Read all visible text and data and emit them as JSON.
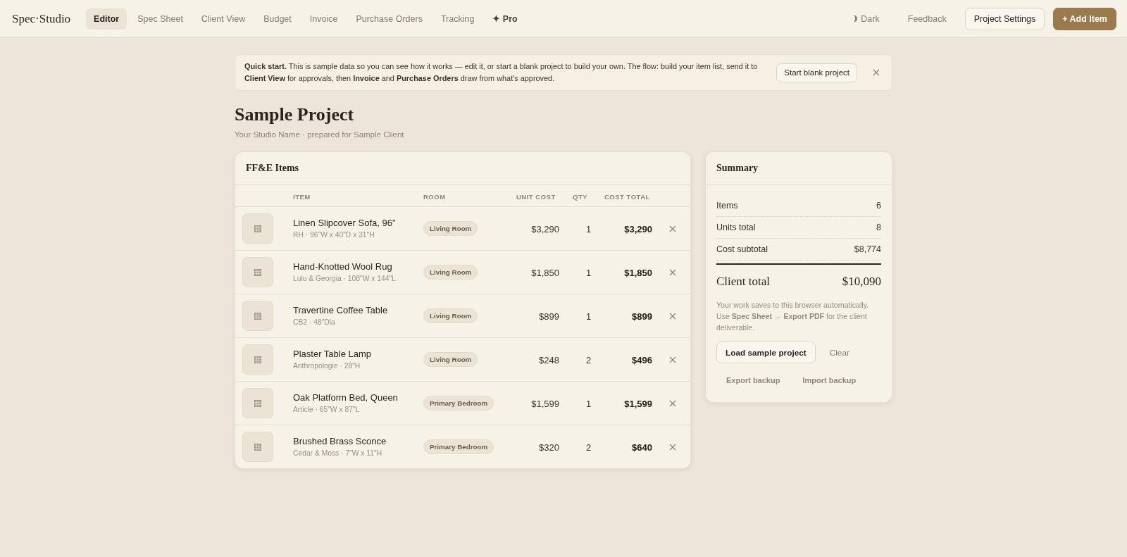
{
  "header": {
    "logo": "Spec·Studio",
    "tabs": [
      {
        "label": "Editor",
        "selected": true
      },
      {
        "label": "Spec Sheet",
        "selected": false
      },
      {
        "label": "Client View",
        "selected": false
      },
      {
        "label": "Budget",
        "selected": false
      },
      {
        "label": "Invoice",
        "selected": false
      },
      {
        "label": "Purchase Orders",
        "selected": false
      },
      {
        "label": "Tracking",
        "selected": false
      }
    ],
    "pro_link": "✦ Pro",
    "theme_toggle": "Dark",
    "feedback_link": "Feedback",
    "settings_button": "Project Settings",
    "add_button": "+ Add Item"
  },
  "banner": {
    "text": "**Quick start.** This is sample data so you can see how it works — edit it, or start a blank project to build your own. The flow: build your item list, send it to **Client View** for approvals, then **Invoice** and **Purchase Orders** draw from what's approved.",
    "button": "Start blank project"
  },
  "project": {
    "title": "Sample Project",
    "subtitle": "Your Studio Name · prepared for Sample Client"
  },
  "items_table": {
    "title": "FF&E Items",
    "columns": [
      "ITEM",
      "ROOM",
      "UNIT COST",
      "QTY",
      "COST TOTAL"
    ],
    "rows": [
      {
        "name": "Linen Slipcover Sofa, 96\"",
        "details": "RH · 96\"W x 40\"D x 31\"H",
        "room": "Living Room",
        "unit_cost": "$3,290",
        "qty": "1",
        "cost_total": "$3,290"
      },
      {
        "name": "Hand-Knotted Wool Rug",
        "details": "Lulu & Georgia · 108\"W x 144\"L",
        "room": "Living Room",
        "unit_cost": "$1,850",
        "qty": "1",
        "cost_total": "$1,850"
      },
      {
        "name": "Travertine Coffee Table",
        "details": "CB2 · 48\"Dia",
        "room": "Living Room",
        "unit_cost": "$899",
        "qty": "1",
        "cost_total": "$899"
      },
      {
        "name": "Plaster Table Lamp",
        "details": "Anthropologie · 28\"H",
        "room": "Living Room",
        "unit_cost": "$248",
        "qty": "2",
        "cost_total": "$496"
      },
      {
        "name": "Oak Platform Bed, Queen",
        "details": "Article · 65\"W x 87\"L",
        "room": "Primary Bedroom",
        "unit_cost": "$1,599",
        "qty": "1",
        "cost_total": "$1,599"
      },
      {
        "name": "Brushed Brass Sconce",
        "details": "Cedar & Moss · 7\"W x 11\"H",
        "room": "Primary Bedroom",
        "unit_cost": "$320",
        "qty": "2",
        "cost_total": "$640"
      }
    ]
  },
  "summary": {
    "title": "Summary",
    "rows": [
      {
        "label": "Items",
        "value": "6"
      },
      {
        "label": "Units total",
        "value": "8"
      },
      {
        "label": "Cost subtotal",
        "value": "$8,774"
      }
    ],
    "total": {
      "label": "Client total",
      "value": "$10,090"
    },
    "note": "Your work saves to this browser automatically. Use **Spec Sheet → Export PDF** for the client deliverable.",
    "actions": [
      {
        "label": "Load sample project",
        "kind": "outline"
      },
      {
        "label": "Clear",
        "kind": "text"
      }
    ],
    "backup_actions": [
      "Export backup",
      "Import backup"
    ]
  }
}
